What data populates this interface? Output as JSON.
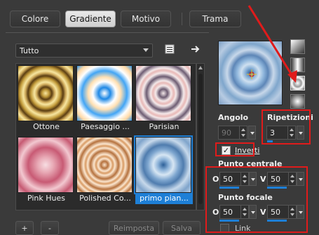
{
  "tabs": [
    {
      "label": "Colore"
    },
    {
      "label": "Gradiente"
    },
    {
      "label": "Motivo"
    },
    {
      "label": "Trama"
    }
  ],
  "category": {
    "value": "Tutto"
  },
  "gradients": [
    {
      "label": "Ottone"
    },
    {
      "label": "Paesaggio ..."
    },
    {
      "label": "Parisian"
    },
    {
      "label": "Pink Hues"
    },
    {
      "label": "Polished Co..."
    },
    {
      "label": "primo pian..."
    }
  ],
  "buttons": {
    "add": "+",
    "remove": "-",
    "reset": "Reimposta",
    "save": "Salva"
  },
  "settings": {
    "angle_label": "Angolo",
    "angle_value": "90",
    "repeats_label": "Ripetizioni",
    "repeats_value": "3",
    "invert_label": "Inverti",
    "center_label": "Punto centrale",
    "center_o": "50",
    "center_v": "50",
    "focal_label": "Punto focale",
    "focal_o": "50",
    "focal_v": "50",
    "o_label": "O",
    "v_label": "V",
    "link_label": "Link"
  },
  "colors": {
    "accent": "#1e7fd6",
    "annotation": "#e01b1b"
  }
}
